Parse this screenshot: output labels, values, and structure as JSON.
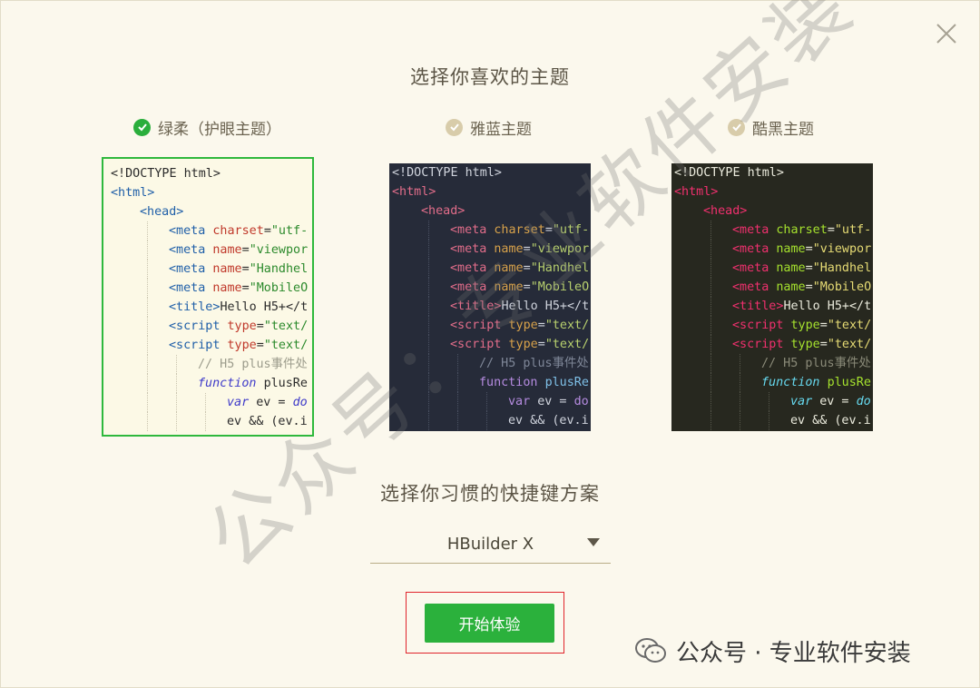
{
  "dialog": {
    "title": "选择你喜欢的主题",
    "subtitle": "选择你习惯的快捷键方案"
  },
  "themes": [
    {
      "label": "绿柔（护眼主题）",
      "selected": true
    },
    {
      "label": "雅蓝主题",
      "selected": false
    },
    {
      "label": "酷黑主题",
      "selected": false
    }
  ],
  "code": {
    "l1": "<!DOCTYPE html>",
    "l2_tag": "<html>",
    "l3_tag": "<head>",
    "meta": "<meta",
    "charset_attr": "charset",
    "charset_val": "\"utf-",
    "name_attr": "name",
    "viewport_val": "\"viewpor",
    "handheld_val": "\"Handhel",
    "mobile_val": "\"MobileO",
    "title_open": "<title>",
    "title_text": "Hello H5+</t",
    "script_tag": "<script",
    "type_attr": "type",
    "type_val": "\"text/",
    "comment": "// H5 plus事件处",
    "function_kw": "function",
    "function_name": "plusRe",
    "var_kw": "var",
    "var_rest": "ev = ",
    "var_do": "do",
    "last_line": "ev && (ev.i"
  },
  "code_short": {
    "charset_val": "\"utf-",
    "viewport_val": "\"viewpor",
    "handheld_val": "\"Handhel",
    "mobile_val": "\"MobileO",
    "title_text": "Hello H5+</",
    "type_val": "\"text/",
    "comment": "// H5 plus事件处",
    "function_name": "plusRe",
    "last_line": "ev && (ev.i"
  },
  "shortcut": {
    "selected": "HBuilder X"
  },
  "start_button": "开始体验",
  "watermark": {
    "diagonal": "公众号：专业软件安装",
    "footer": "公众号 · 专业软件安装"
  },
  "colors": {
    "accent_green": "#2bb13c",
    "highlight_red": "#e0232b",
    "background": "#fbf8ed"
  }
}
